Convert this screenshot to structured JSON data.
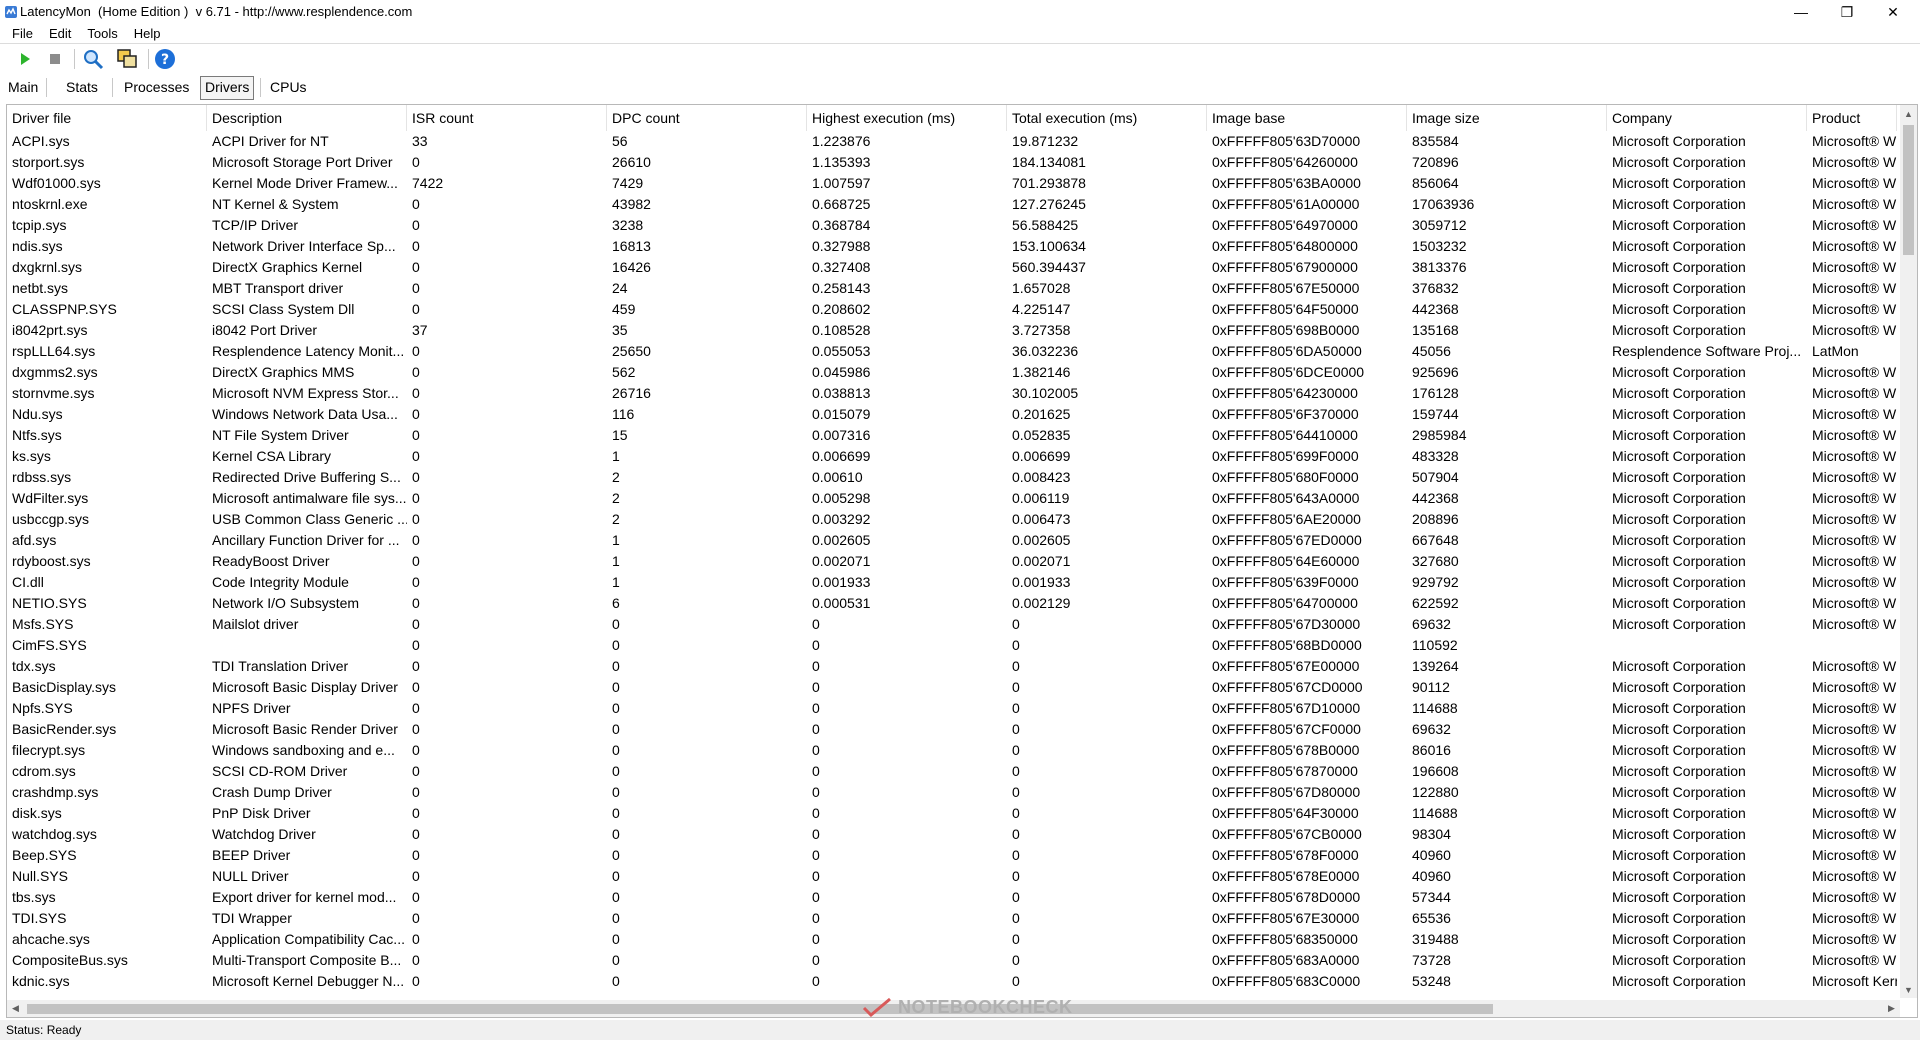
{
  "window": {
    "title": "LatencyMon  (Home Edition )  v 6.71 - http://www.resplendence.com",
    "minimize_glyph": "—",
    "restore_glyph": "❐",
    "close_glyph": "✕"
  },
  "menu": [
    "File",
    "Edit",
    "Tools",
    "Help"
  ],
  "toolbar": {
    "buttons": [
      {
        "name": "start-monitor",
        "icon": "play-icon",
        "color": "#2db42d"
      },
      {
        "name": "stop-monitor",
        "icon": "stop-icon",
        "color": "#8c8c8c"
      },
      {
        "name": "find",
        "icon": "search-icon",
        "color": "#1f6fc4"
      },
      {
        "name": "windows",
        "icon": "copy-windows-icon",
        "color": "#e0b020"
      },
      {
        "name": "help",
        "icon": "help-icon",
        "color": "#1d6fd8"
      }
    ]
  },
  "tabs": [
    "Main",
    "Stats",
    "Processes",
    "Drivers",
    "CPUs"
  ],
  "active_tab": "Drivers",
  "columns": [
    "Driver file",
    "Description",
    "ISR count",
    "DPC count",
    "Highest execution (ms)",
    "Total execution (ms)",
    "Image base",
    "Image size",
    "Company",
    "Product"
  ],
  "rows": [
    [
      "ACPI.sys",
      "ACPI Driver for NT",
      "33",
      "56",
      "1.223876",
      "19.871232",
      "0xFFFFF805'63D70000",
      "835584",
      "Microsoft Corporation",
      "Microsoft® W"
    ],
    [
      "storport.sys",
      "Microsoft Storage Port Driver",
      "0",
      "26610",
      "1.135393",
      "184.134081",
      "0xFFFFF805'64260000",
      "720896",
      "Microsoft Corporation",
      "Microsoft® W"
    ],
    [
      "Wdf01000.sys",
      "Kernel Mode Driver Framew...",
      "7422",
      "7429",
      "1.007597",
      "701.293878",
      "0xFFFFF805'63BA0000",
      "856064",
      "Microsoft Corporation",
      "Microsoft® W"
    ],
    [
      "ntoskrnl.exe",
      "NT Kernel & System",
      "0",
      "43982",
      "0.668725",
      "127.276245",
      "0xFFFFF805'61A00000",
      "17063936",
      "Microsoft Corporation",
      "Microsoft® W"
    ],
    [
      "tcpip.sys",
      "TCP/IP Driver",
      "0",
      "3238",
      "0.368784",
      "56.588425",
      "0xFFFFF805'64970000",
      "3059712",
      "Microsoft Corporation",
      "Microsoft® W"
    ],
    [
      "ndis.sys",
      "Network Driver Interface Sp...",
      "0",
      "16813",
      "0.327988",
      "153.100634",
      "0xFFFFF805'64800000",
      "1503232",
      "Microsoft Corporation",
      "Microsoft® W"
    ],
    [
      "dxgkrnl.sys",
      "DirectX Graphics Kernel",
      "0",
      "16426",
      "0.327408",
      "560.394437",
      "0xFFFFF805'67900000",
      "3813376",
      "Microsoft Corporation",
      "Microsoft® W"
    ],
    [
      "netbt.sys",
      "MBT Transport driver",
      "0",
      "24",
      "0.258143",
      "1.657028",
      "0xFFFFF805'67E50000",
      "376832",
      "Microsoft Corporation",
      "Microsoft® W"
    ],
    [
      "CLASSPNP.SYS",
      "SCSI Class System Dll",
      "0",
      "459",
      "0.208602",
      "4.225147",
      "0xFFFFF805'64F50000",
      "442368",
      "Microsoft Corporation",
      "Microsoft® W"
    ],
    [
      "i8042prt.sys",
      "i8042 Port Driver",
      "37",
      "35",
      "0.108528",
      "3.727358",
      "0xFFFFF805'698B0000",
      "135168",
      "Microsoft Corporation",
      "Microsoft® W"
    ],
    [
      "rspLLL64.sys",
      "Resplendence Latency Monit...",
      "0",
      "25650",
      "0.055053",
      "36.032236",
      "0xFFFFF805'6DA50000",
      "45056",
      "Resplendence Software Proj...",
      "LatMon"
    ],
    [
      "dxgmms2.sys",
      "DirectX Graphics MMS",
      "0",
      "562",
      "0.045986",
      "1.382146",
      "0xFFFFF805'6DCE0000",
      "925696",
      "Microsoft Corporation",
      "Microsoft® W"
    ],
    [
      "stornvme.sys",
      "Microsoft NVM Express Stor...",
      "0",
      "26716",
      "0.038813",
      "30.102005",
      "0xFFFFF805'64230000",
      "176128",
      "Microsoft Corporation",
      "Microsoft® W"
    ],
    [
      "Ndu.sys",
      "Windows Network Data Usa...",
      "0",
      "116",
      "0.015079",
      "0.201625",
      "0xFFFFF805'6F370000",
      "159744",
      "Microsoft Corporation",
      "Microsoft® W"
    ],
    [
      "Ntfs.sys",
      "NT File System Driver",
      "0",
      "15",
      "0.007316",
      "0.052835",
      "0xFFFFF805'64410000",
      "2985984",
      "Microsoft Corporation",
      "Microsoft® W"
    ],
    [
      "ks.sys",
      "Kernel CSA Library",
      "0",
      "1",
      "0.006699",
      "0.006699",
      "0xFFFFF805'699F0000",
      "483328",
      "Microsoft Corporation",
      "Microsoft® W"
    ],
    [
      "rdbss.sys",
      "Redirected Drive Buffering S...",
      "0",
      "2",
      "0.00610",
      "0.008423",
      "0xFFFFF805'680F0000",
      "507904",
      "Microsoft Corporation",
      "Microsoft® W"
    ],
    [
      "WdFilter.sys",
      "Microsoft antimalware file sys...",
      "0",
      "2",
      "0.005298",
      "0.006119",
      "0xFFFFF805'643A0000",
      "442368",
      "Microsoft Corporation",
      "Microsoft® W"
    ],
    [
      "usbccgp.sys",
      "USB Common Class Generic ...",
      "0",
      "2",
      "0.003292",
      "0.006473",
      "0xFFFFF805'6AE20000",
      "208896",
      "Microsoft Corporation",
      "Microsoft® W"
    ],
    [
      "afd.sys",
      "Ancillary Function Driver for ...",
      "0",
      "1",
      "0.002605",
      "0.002605",
      "0xFFFFF805'67ED0000",
      "667648",
      "Microsoft Corporation",
      "Microsoft® W"
    ],
    [
      "rdyboost.sys",
      "ReadyBoost Driver",
      "0",
      "1",
      "0.002071",
      "0.002071",
      "0xFFFFF805'64E60000",
      "327680",
      "Microsoft Corporation",
      "Microsoft® W"
    ],
    [
      "CI.dll",
      "Code Integrity Module",
      "0",
      "1",
      "0.001933",
      "0.001933",
      "0xFFFFF805'639F0000",
      "929792",
      "Microsoft Corporation",
      "Microsoft® W"
    ],
    [
      "NETIO.SYS",
      "Network I/O Subsystem",
      "0",
      "6",
      "0.000531",
      "0.002129",
      "0xFFFFF805'64700000",
      "622592",
      "Microsoft Corporation",
      "Microsoft® W"
    ],
    [
      "Msfs.SYS",
      "Mailslot driver",
      "0",
      "0",
      "0",
      "0",
      "0xFFFFF805'67D30000",
      "69632",
      "Microsoft Corporation",
      "Microsoft® W"
    ],
    [
      "CimFS.SYS",
      "",
      "0",
      "0",
      "0",
      "0",
      "0xFFFFF805'68BD0000",
      "110592",
      "",
      ""
    ],
    [
      "tdx.sys",
      "TDI Translation Driver",
      "0",
      "0",
      "0",
      "0",
      "0xFFFFF805'67E00000",
      "139264",
      "Microsoft Corporation",
      "Microsoft® W"
    ],
    [
      "BasicDisplay.sys",
      "Microsoft Basic Display Driver",
      "0",
      "0",
      "0",
      "0",
      "0xFFFFF805'67CD0000",
      "90112",
      "Microsoft Corporation",
      "Microsoft® W"
    ],
    [
      "Npfs.SYS",
      "NPFS Driver",
      "0",
      "0",
      "0",
      "0",
      "0xFFFFF805'67D10000",
      "114688",
      "Microsoft Corporation",
      "Microsoft® W"
    ],
    [
      "BasicRender.sys",
      "Microsoft Basic Render Driver",
      "0",
      "0",
      "0",
      "0",
      "0xFFFFF805'67CF0000",
      "69632",
      "Microsoft Corporation",
      "Microsoft® W"
    ],
    [
      "filecrypt.sys",
      "Windows sandboxing and e...",
      "0",
      "0",
      "0",
      "0",
      "0xFFFFF805'678B0000",
      "86016",
      "Microsoft Corporation",
      "Microsoft® W"
    ],
    [
      "cdrom.sys",
      "SCSI CD-ROM Driver",
      "0",
      "0",
      "0",
      "0",
      "0xFFFFF805'67870000",
      "196608",
      "Microsoft Corporation",
      "Microsoft® W"
    ],
    [
      "crashdmp.sys",
      "Crash Dump Driver",
      "0",
      "0",
      "0",
      "0",
      "0xFFFFF805'67D80000",
      "122880",
      "Microsoft Corporation",
      "Microsoft® W"
    ],
    [
      "disk.sys",
      "PnP Disk Driver",
      "0",
      "0",
      "0",
      "0",
      "0xFFFFF805'64F30000",
      "114688",
      "Microsoft Corporation",
      "Microsoft® W"
    ],
    [
      "watchdog.sys",
      "Watchdog Driver",
      "0",
      "0",
      "0",
      "0",
      "0xFFFFF805'67CB0000",
      "98304",
      "Microsoft Corporation",
      "Microsoft® W"
    ],
    [
      "Beep.SYS",
      "BEEP Driver",
      "0",
      "0",
      "0",
      "0",
      "0xFFFFF805'678F0000",
      "40960",
      "Microsoft Corporation",
      "Microsoft® W"
    ],
    [
      "Null.SYS",
      "NULL Driver",
      "0",
      "0",
      "0",
      "0",
      "0xFFFFF805'678E0000",
      "40960",
      "Microsoft Corporation",
      "Microsoft® W"
    ],
    [
      "tbs.sys",
      "Export driver for kernel mod...",
      "0",
      "0",
      "0",
      "0",
      "0xFFFFF805'678D0000",
      "57344",
      "Microsoft Corporation",
      "Microsoft® W"
    ],
    [
      "TDI.SYS",
      "TDI Wrapper",
      "0",
      "0",
      "0",
      "0",
      "0xFFFFF805'67E30000",
      "65536",
      "Microsoft Corporation",
      "Microsoft® W"
    ],
    [
      "ahcache.sys",
      "Application Compatibility Cac...",
      "0",
      "0",
      "0",
      "0",
      "0xFFFFF805'68350000",
      "319488",
      "Microsoft Corporation",
      "Microsoft® W"
    ],
    [
      "CompositeBus.sys",
      "Multi-Transport Composite B...",
      "0",
      "0",
      "0",
      "0",
      "0xFFFFF805'683A0000",
      "73728",
      "Microsoft Corporation",
      "Microsoft® W"
    ],
    [
      "kdnic.sys",
      "Microsoft Kernel Debugger N...",
      "0",
      "0",
      "0",
      "0",
      "0xFFFFF805'683C0000",
      "53248",
      "Microsoft Corporation",
      "Microsoft Kerr"
    ]
  ],
  "status": "Status: Ready",
  "watermark": "NOTEBOOKCHECK"
}
